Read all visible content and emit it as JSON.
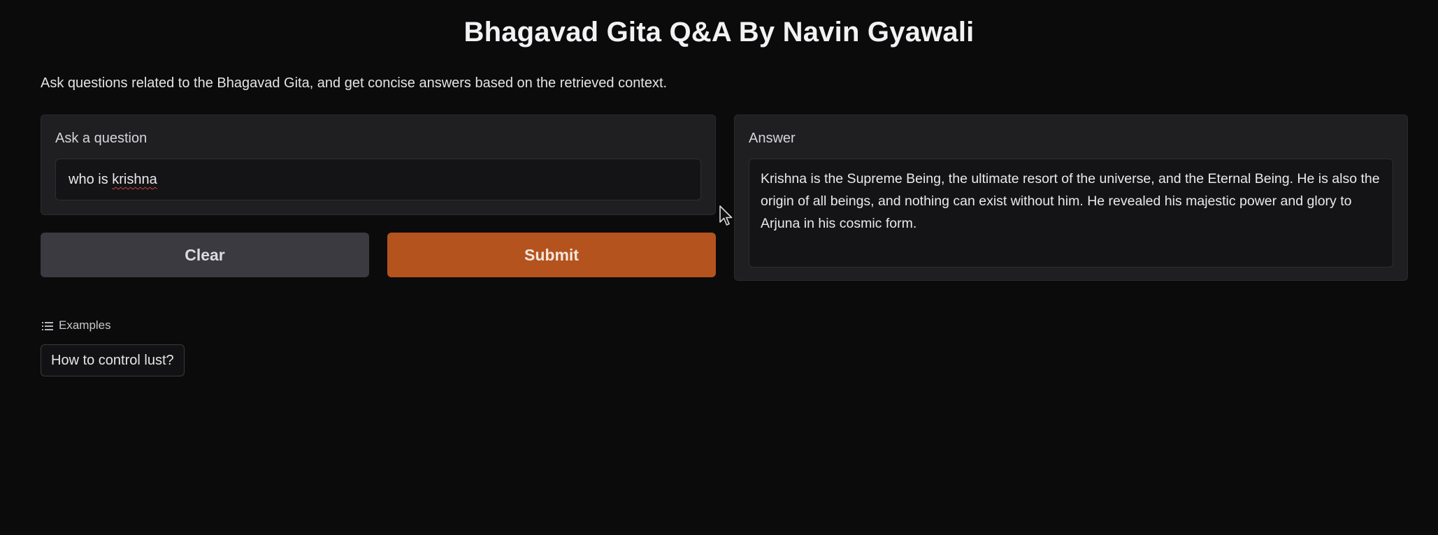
{
  "header": {
    "title": "Bhagavad Gita Q&A By Navin Gyawali",
    "description": "Ask questions related to the Bhagavad Gita, and get concise answers based on the retrieved context."
  },
  "question_panel": {
    "label": "Ask a question",
    "input_value_word1": "who is ",
    "input_value_word2": "krishna"
  },
  "answer_panel": {
    "label": "Answer",
    "text": "Krishna is the Supreme Being, the ultimate resort of the universe, and the Eternal Being. He is also the origin of all beings, and nothing can exist without him.  He revealed his majestic power and glory to Arjuna in his cosmic form."
  },
  "buttons": {
    "clear_label": "Clear",
    "submit_label": "Submit"
  },
  "examples": {
    "header_label": "Examples",
    "items": [
      "How to control lust?"
    ]
  },
  "icons": {
    "examples": "list-icon",
    "pointer": "mouse-cursor-icon"
  },
  "colors": {
    "background": "#0b0b0c",
    "panel": "#1f1f22",
    "submit_accent": "#b4531e",
    "clear_button": "#3a3a40"
  }
}
